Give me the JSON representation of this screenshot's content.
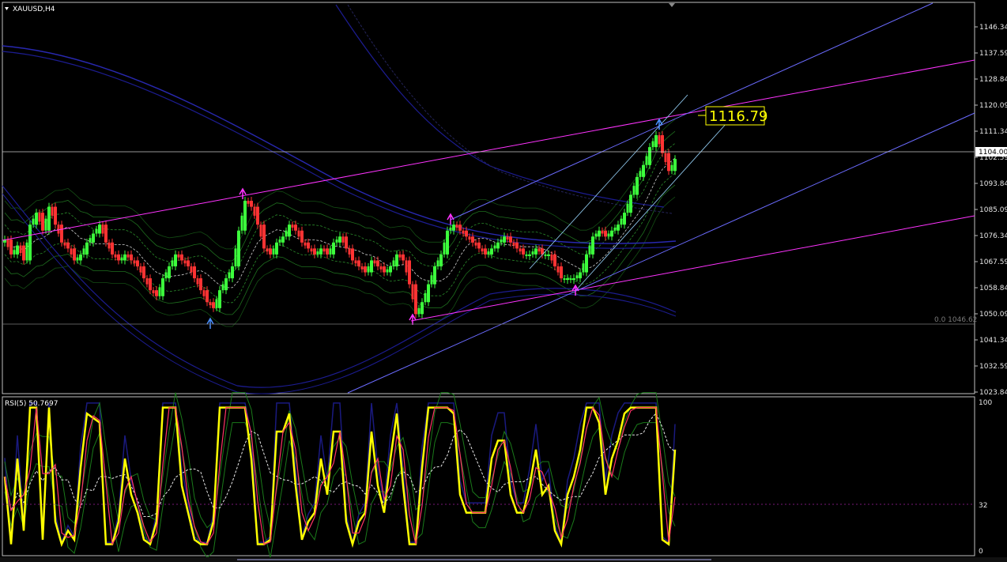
{
  "symbol": "XAUUSD,H4",
  "main_chart": {
    "price_ticks": [
      "1146.34",
      "1137.59",
      "1128.84",
      "1120.09",
      "1111.34",
      "1102.59",
      "1093.84",
      "1085.09",
      "1076.34",
      "1067.59",
      "1058.84",
      "1050.09",
      "1041.34",
      "1032.59",
      "1023.84"
    ],
    "current_price": "1104.00",
    "callout_price": "1116.79",
    "fib_label": "0.0 1046.62"
  },
  "rsi_panel": {
    "title": "RSI(5) 50.7697",
    "ticks": [
      "100",
      "32",
      "0"
    ]
  },
  "colors": {
    "bull": "#3cff3c",
    "bear": "#ff3333",
    "channel_magenta": "#ff33ff",
    "channel_blue": "#6b6bff",
    "grid_white": "#c8c8c8",
    "rsi_yellow": "#ffff00",
    "rsi_navy": "#1a1a80"
  }
}
